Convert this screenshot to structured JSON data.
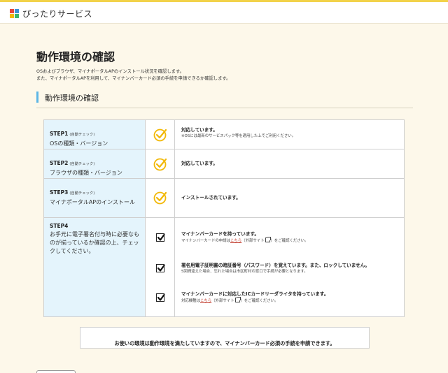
{
  "header": {
    "site_name": "ぴったりサービス",
    "logo_icon": "pittari-logo-icon"
  },
  "page": {
    "title": "動作環境の確認",
    "description_line1": "OSおよびブラウザ、マイナポータルAPのインストール状況を確認します。",
    "description_line2": "また、マイナポータルAPを利用して、マイナンバーカード必須の手続を申請できるか確認します。"
  },
  "section": {
    "title": "動作環境の確認",
    "accent_color": "#5cb6e5"
  },
  "steps": [
    {
      "label": "STEP1",
      "sub": "(自動チェック)",
      "name": "OSの種類・バージョン",
      "icon": "check-circle-icon",
      "result_title": "対応しています。",
      "result_note": "※OSには最新のサービスパック等を適用した上でご利用ください。"
    },
    {
      "label": "STEP2",
      "sub": "(自動チェック)",
      "name": "ブラウザの種類・バージョン",
      "icon": "check-circle-icon",
      "result_title": "対応しています。"
    },
    {
      "label": "STEP3",
      "sub": "(自動チェック)",
      "name": "マイナポータルAPのインストール",
      "icon": "check-circle-icon",
      "result_title": "インストールされています。"
    },
    {
      "label": "STEP4",
      "name": "お手元に電子署名付与時に必要なものが揃っているか確認の上、チェックしてください。",
      "items": [
        {
          "title": "マイナンバーカードを持っています。",
          "note_before": "マイナンバーカードの申請は",
          "link": "こちら",
          "note_after": "（外部サイト",
          "note_end": "）をご確認ください。",
          "checked": true
        },
        {
          "title": "署名用電子証明書の暗証番号（パスワード）を覚えています。また、ロックしていません。",
          "note": "5回間違えた場合、忘れた場合は市区町村の窓口で手続が必要となります。",
          "checked": true
        },
        {
          "title": "マイナンバーカードに対応したICカードリーダライタを持っています。",
          "note_before": "対応機種は",
          "link": "こちら",
          "note_after": "（外部サイト",
          "note_end": "）をご確認ください。",
          "checked": true
        }
      ]
    }
  ],
  "result_message": "お使いの環境は動作環境を満たしていますので、マイナンバーカード必須の手続を申請できます。",
  "colors": {
    "background": "#fdf8ea",
    "header_stripe": "#f2d24a",
    "step_cell": "#e4f4fc",
    "check_icon": "#f2b807",
    "link": "#c0392b"
  }
}
